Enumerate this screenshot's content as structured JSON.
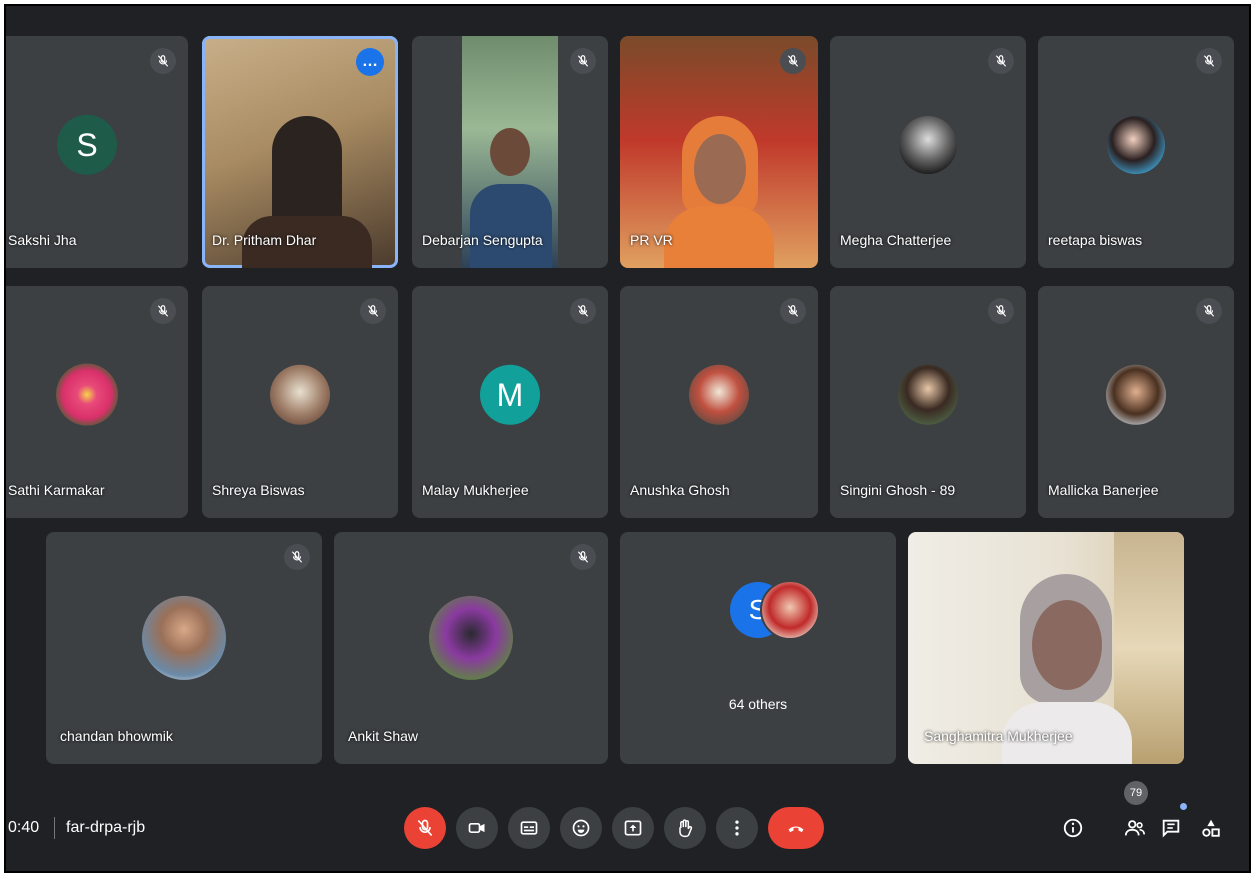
{
  "participants": {
    "sakshi": {
      "name": "Sakshi Jha",
      "initial": "S",
      "avatar_color": "#1e5b48"
    },
    "pritham": {
      "name": "Dr. Pritham Dhar",
      "more_label": "…"
    },
    "debarjan": {
      "name": "Debarjan Sengupta"
    },
    "prvr": {
      "name": "PR VR"
    },
    "megha": {
      "name": "Megha Chatterjee"
    },
    "reetapa": {
      "name": "reetapa biswas"
    },
    "sathi": {
      "name": "Sathi Karmakar"
    },
    "shreya": {
      "name": "Shreya Biswas"
    },
    "malay": {
      "name": "Malay Mukherjee",
      "initial": "M",
      "avatar_color": "#12a09a"
    },
    "anushka": {
      "name": "Anushka Ghosh"
    },
    "singini": {
      "name": "Singini Ghosh - 89"
    },
    "mallicka": {
      "name": "Mallicka Banerjee"
    },
    "chandan": {
      "name": "chandan bhowmik"
    },
    "ankit": {
      "name": "Ankit Shaw"
    },
    "others": {
      "label": "64 others",
      "initial": "S",
      "avatar_color": "#1a73e8"
    },
    "sanghamitra": {
      "name": "Sanghamitra Mukherjee"
    }
  },
  "meeting": {
    "time": "0:40",
    "code": "far-drpa-rjb"
  },
  "people_count": "79",
  "icons": {
    "mic": "mic-off-icon",
    "camera": "camera-icon",
    "captions": "captions-icon",
    "emoji": "emoji-icon",
    "present": "present-screen-icon",
    "hand": "raise-hand-icon",
    "more": "more-vert-icon",
    "end": "end-call-icon",
    "info": "info-icon",
    "people": "people-icon",
    "chat": "chat-icon",
    "activities": "activities-icon"
  }
}
